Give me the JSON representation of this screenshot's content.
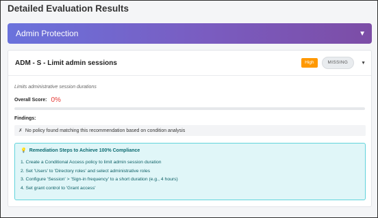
{
  "page": {
    "title": "Detailed Evaluation Results"
  },
  "section": {
    "title": "Admin Protection",
    "caret": "▼"
  },
  "card": {
    "title": "ADM - S - Limit admin sessions",
    "severity": "High",
    "status": "MISSING",
    "caret": "▼",
    "description": "Limits administrative session durations",
    "score_label": "Overall Score:",
    "score_value": "0%",
    "score_fraction": 0,
    "findings_label": "Findings:",
    "finding": {
      "icon": "✗",
      "text": "No policy found matching this recommendation based on condition analysis"
    },
    "remediation": {
      "icon": "💡",
      "title": "Remediation Steps to Achieve 100% Compliance",
      "steps": [
        "1. Create a Conditional Access policy to limit admin session duration",
        "2. Set 'Users' to 'Directory roles' and select administrative roles",
        "3. Configure 'Session' > 'Sign-in frequency' to a short duration (e.g., 4 hours)",
        "4. Set grant control to 'Grant access'"
      ]
    }
  },
  "colors": {
    "score": "#e53935",
    "severity_high": "#ff9800",
    "header_gradient_start": "#6a72dc",
    "header_gradient_end": "#7c4da6",
    "remediation_border": "#5fd3db"
  }
}
